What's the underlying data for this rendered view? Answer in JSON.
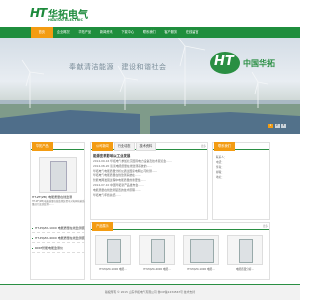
{
  "colors": {
    "brand_green": "#1f8e3d",
    "accent_orange": "#f39c12"
  },
  "logo": {
    "mark": "HT",
    "cn": "华拓电气",
    "en": "HUATUO ELECTRIC"
  },
  "nav": {
    "items": [
      "首页",
      "企业概况",
      "华拓产品",
      "新闻资讯",
      "下载中心",
      "联系我们",
      "客户服务",
      "在线留言"
    ],
    "active": 0
  },
  "banner": {
    "slogan": "奉献清洁能源　建设和谐社会",
    "badge": "HT",
    "brand": "中国华拓",
    "pager": [
      "1",
      "2",
      "3"
    ]
  },
  "products_panel": {
    "title": "华拓产品",
    "product_name": "HT-ZF(ZB) 电能质量在线监测",
    "product_desc": "HT-ZF(ZB)电能质量在线监测装置可对电网电能质量进行连续监测……",
    "list": [
      "HT-PQZX-1000 电能质量在线监测装置",
      "HT-PQZX-4000 电能质量在线监测装置",
      "RDM智能电能监测仪"
    ]
  },
  "news_panel": {
    "tabs": [
      "公司新闻",
      "行业动态",
      "技术资料"
    ],
    "more": "更多",
    "headline": "能源变革影响以工业发展",
    "lines": [
      "2014-09-16 华拓电气参加北京国际电力设备及技术展览会……",
      "2014-08-20 谈谈电能质量在线监测系统的……",
      "华拓电气电能质量分析仪通过国家电网公司检测……",
      "华拓电气电能质量在线监测系统在……",
      "智能电网发展过程中电能质量的重要性……",
      "2014-07-10 中国华拓新产品发布会……",
      "电能质量在线监测装置的技术原理……",
      "华拓电气年终总结……"
    ]
  },
  "contact_panel": {
    "title": "联系我们",
    "lines": [
      "联系人：",
      "电话：",
      "传真：",
      "邮箱：",
      "地址："
    ]
  },
  "gallery": {
    "title": "产品展示",
    "items": [
      "HT-PQZX-1000 电能…",
      "HT-PQZX-4000 电能…",
      "HT-PQZX-1000 电能…",
      "电能质量分析…"
    ]
  },
  "footer": {
    "text": "版权所有 © 2015 山东华拓电气有限公司 鲁ICP备1234567号 技术支持"
  }
}
